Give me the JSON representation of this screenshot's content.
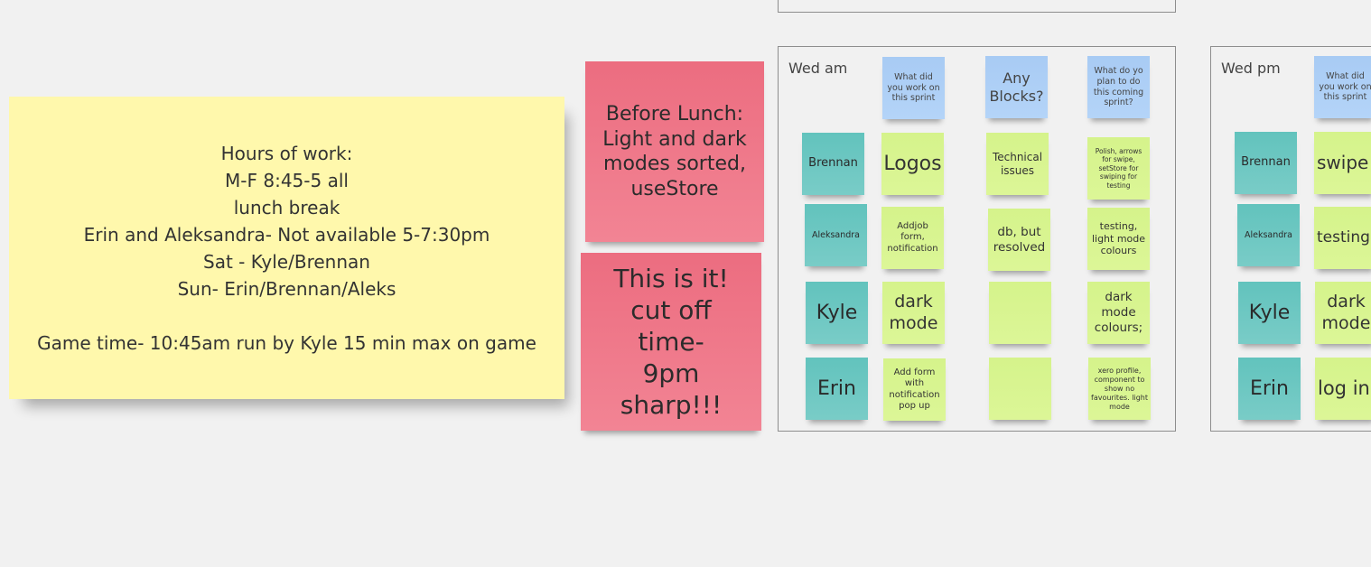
{
  "notes": {
    "hours": [
      "Hours of work:",
      "M-F 8:45-5 all",
      "lunch break",
      "Erin and Aleksandra- Not available 5-7:30pm",
      "Sat - Kyle/Brennan",
      "Sun- Erin/Brennan/Aleks",
      "",
      "Game time- 10:45am run by Kyle 15 min max on game"
    ],
    "before_lunch": "Before Lunch: Light and dark modes sorted, useStore",
    "cutoff": "This is it! cut off time- 9pm sharp!!!"
  },
  "wed_am": {
    "title": "Wed am",
    "headers": [
      "What did you work on this sprint",
      "Any Blocks?",
      "What do yo plan to do this coming sprint?"
    ],
    "rows": [
      {
        "name": "Brennan",
        "worked": "Logos",
        "blocks": "Technical issues",
        "plan": "Polish, arrows for swipe, setStore for swiping for testing"
      },
      {
        "name": "Aleksandra",
        "worked": "Addjob form, notification",
        "blocks": "db, but resolved",
        "plan": "testing, light mode colours"
      },
      {
        "name": "Kyle",
        "worked": "dark mode",
        "blocks": "",
        "plan": "dark mode colours;"
      },
      {
        "name": "Erin",
        "worked": "Add form with notification pop up",
        "blocks": "",
        "plan": "xero profile, component to show no favourites. light mode"
      }
    ]
  },
  "wed_pm": {
    "title": "Wed pm",
    "headers": [
      "What did you work on this sprint"
    ],
    "rows": [
      {
        "name": "Brennan",
        "worked": "swipe"
      },
      {
        "name": "Aleksandra",
        "worked": "testing"
      },
      {
        "name": "Kyle",
        "worked": "dark mode"
      },
      {
        "name": "Erin",
        "worked": "log in"
      }
    ]
  }
}
